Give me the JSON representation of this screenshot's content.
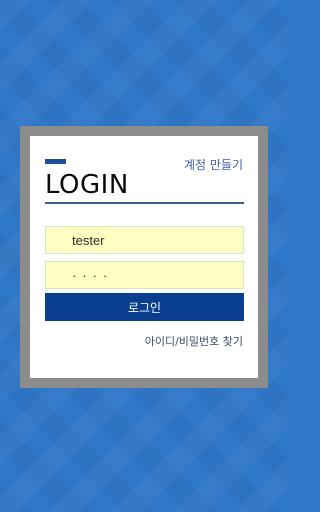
{
  "header": {
    "create_account_label": "계정 만들기",
    "title": "LOGIN"
  },
  "form": {
    "username_value": "tester",
    "password_value": "····",
    "login_button_label": "로그인",
    "find_link_label": "아이디/비밀번호 찾기"
  },
  "colors": {
    "background": "#2f77c8",
    "frame": "#8c8c8c",
    "card": "#ffffff",
    "accent": "#1f4f9b",
    "input_bg": "#ffffc4",
    "button_bg": "#0a3f8f"
  }
}
